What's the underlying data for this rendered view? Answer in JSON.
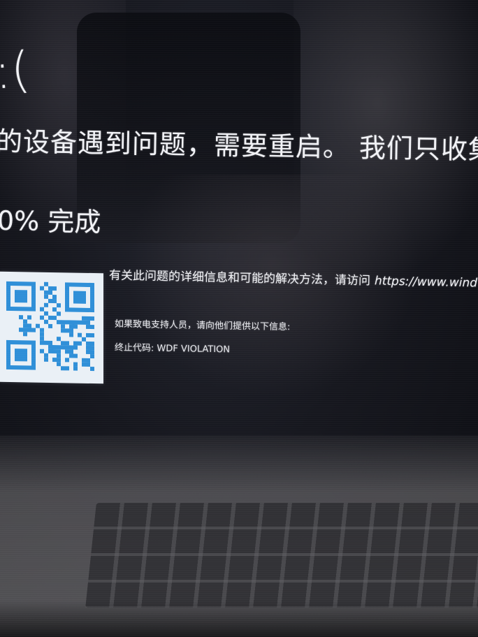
{
  "bsod": {
    "sad_face": ":(",
    "headline": "的设备遇到问题，需要重启。 我们只收集某",
    "progress": "0% 完成",
    "info_text": "有关此问题的详细信息和可能的解决方法，请访问",
    "info_url": "https://www.wind",
    "support_text": "如果致电支持人员，请向他们提供以下信息:",
    "stop_code": "终止代码: WDF VIOLATION"
  },
  "colors": {
    "screen_background": "#0e0f14",
    "text": "#f1f2f6",
    "qr_foreground": "#2f8fd8",
    "qr_background": "#eaf0f6"
  },
  "icons": {
    "qr": "qr-code-icon"
  }
}
